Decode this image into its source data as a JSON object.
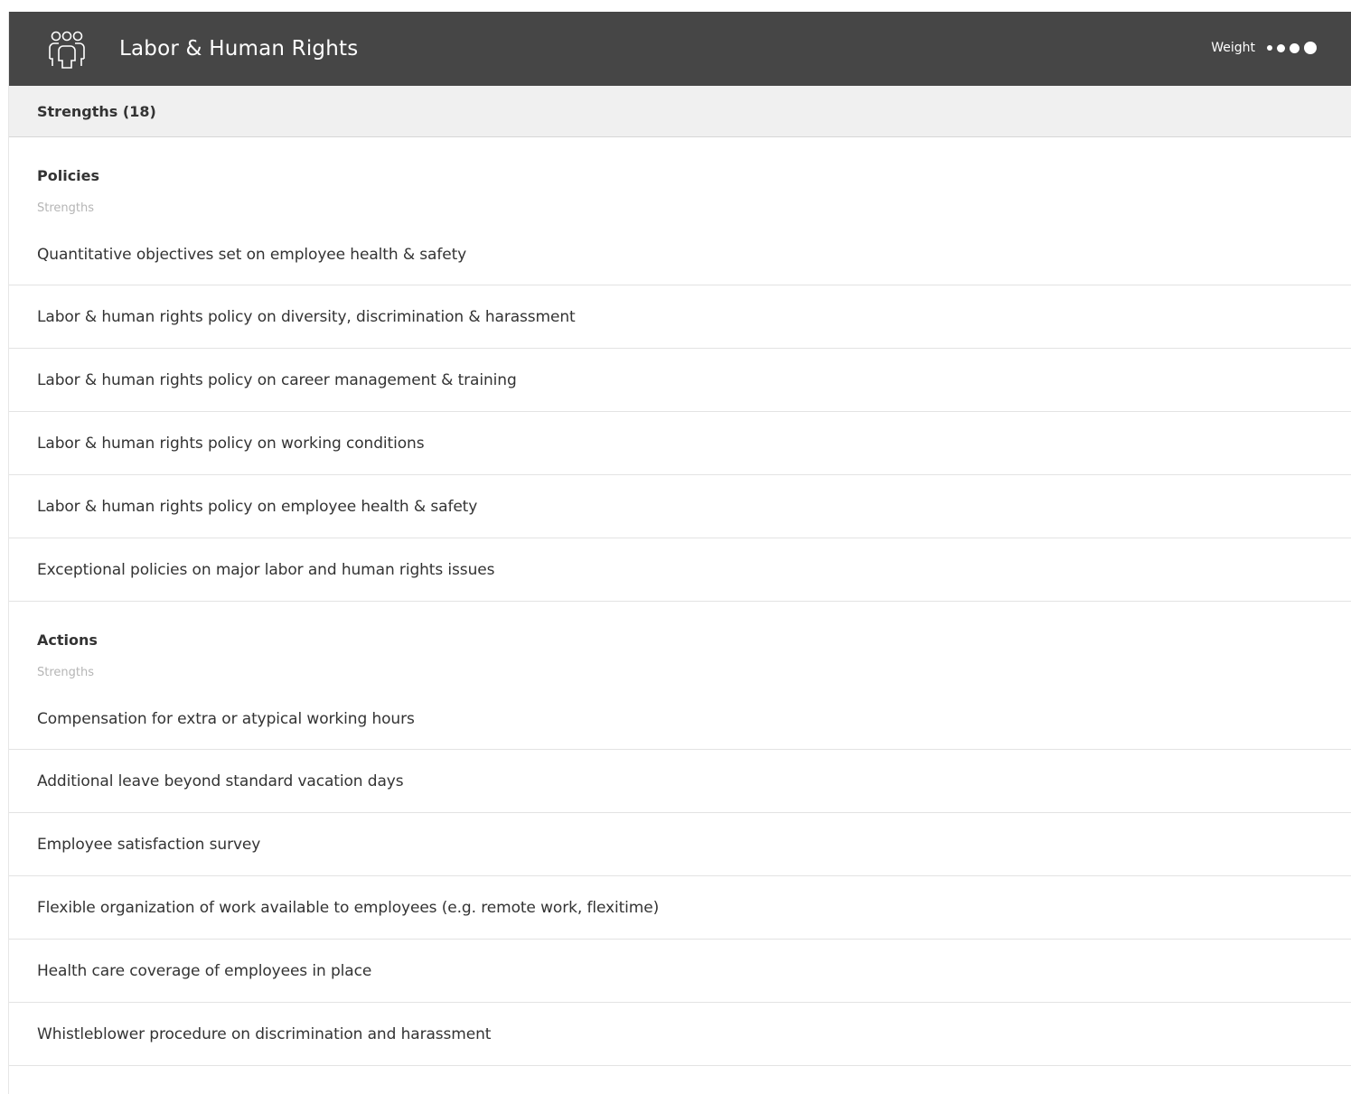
{
  "header": {
    "title": "Labor & Human Rights",
    "icon": "people-group-icon",
    "weight_label": "Weight",
    "weight_level": 4,
    "weight_max": 4
  },
  "strengths_bar": {
    "label": "Strengths (18)"
  },
  "sections": [
    {
      "title": "Policies",
      "subtitle": "Strengths",
      "items": [
        "Quantitative objectives set on employee health & safety",
        "Labor & human rights policy on diversity, discrimination & harassment",
        "Labor & human rights policy on career management & training",
        "Labor & human rights policy on working conditions",
        "Labor & human rights policy on employee health & safety",
        "Exceptional policies on major labor and human rights issues"
      ]
    },
    {
      "title": "Actions",
      "subtitle": "Strengths",
      "items": [
        "Compensation for extra or atypical working hours",
        "Additional leave beyond standard vacation days",
        "Employee satisfaction survey",
        "Flexible organization of work available to employees (e.g. remote work, flexitime)",
        "Health care coverage of employees in place",
        "Whistleblower procedure on discrimination and harassment"
      ]
    }
  ],
  "colors": {
    "header_bg": "#464646",
    "strengths_bg": "#f0f0f0",
    "text": "#333333",
    "subtle_text": "#b5b5b5",
    "divider": "#e3e3e3"
  }
}
